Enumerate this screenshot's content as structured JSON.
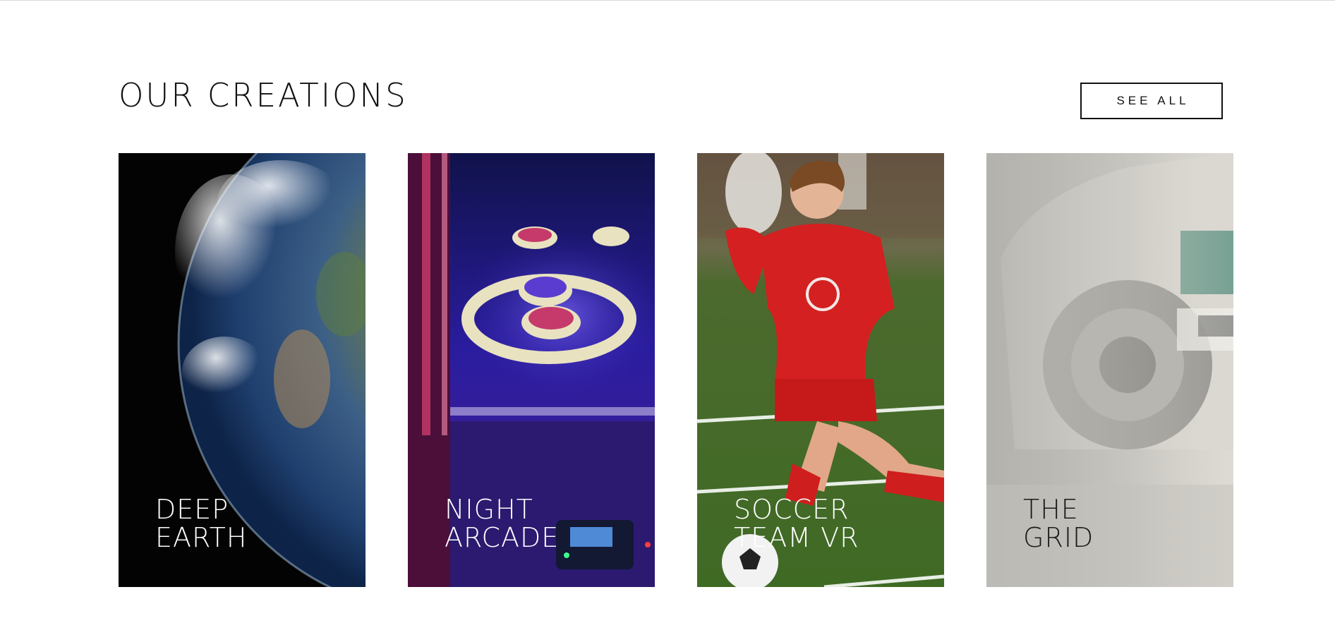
{
  "section": {
    "title": "OUR CREATIONS",
    "see_all_label": "SEE ALL"
  },
  "cards": [
    {
      "line1": "DEEP",
      "line2": "EARTH",
      "text_color": "#ffffff",
      "image": "earth-from-space"
    },
    {
      "line1": "NIGHT",
      "line2": "ARCADE",
      "text_color": "#ffffff",
      "image": "skee-ball-arcade"
    },
    {
      "line1": "SOCCER",
      "line2": "TEAM VR",
      "text_color": "#ffffff",
      "image": "soccer-player"
    },
    {
      "line1": "THE",
      "line2": "GRID",
      "text_color": "#1a1a1a",
      "image": "race-car"
    }
  ]
}
